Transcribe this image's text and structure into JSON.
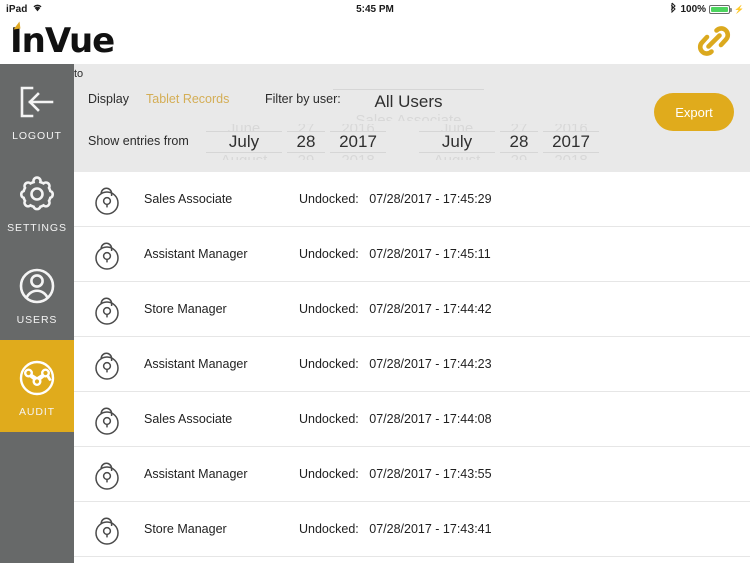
{
  "statusbar": {
    "device": "iPad",
    "wifi_icon": "wifi-icon",
    "time": "5:45 PM",
    "bluetooth_icon": "bluetooth-icon",
    "battery_percent": "100%",
    "charging_icon": "charging-bolt-icon"
  },
  "brand": {
    "logo_text": "InVue",
    "logo_accent_color": "#e0a924",
    "link_icon": "chain-link-icon",
    "link_icon_color": "#e0ab1c"
  },
  "theme": {
    "accent": "#e0ab1c",
    "sidebar_bg": "#676969",
    "filterbar_bg": "#e9e9e9",
    "muted_gold": "#d4ae56"
  },
  "sidebar": {
    "items": [
      {
        "label": "LOGOUT",
        "icon": "logout-arrow-icon",
        "active": false
      },
      {
        "label": "SETTINGS",
        "icon": "gear-icon",
        "active": false
      },
      {
        "label": "USERS",
        "icon": "user-circle-icon",
        "active": false
      },
      {
        "label": "AUDIT",
        "icon": "network-graph-icon",
        "active": true
      }
    ]
  },
  "filterbar": {
    "display_label": "Display",
    "display_value": "Tablet Records",
    "filter_by_user_label": "Filter by user:",
    "user_picker": {
      "selected": "All Users",
      "next_option": "Sales Associate"
    },
    "show_entries_label": "Show entries from",
    "to_label": "to",
    "from_date": {
      "month": "July",
      "day": "28",
      "year": "2017"
    },
    "to_date": {
      "month": "July",
      "day": "28",
      "year": "2017"
    },
    "export_label": "Export"
  },
  "records": [
    {
      "icon": "unlocked-padlock-icon",
      "role": "Sales Associate",
      "event": "Undocked:",
      "timestamp": "07/28/2017 - 17:45:29"
    },
    {
      "icon": "unlocked-padlock-icon",
      "role": "Assistant Manager",
      "event": "Undocked:",
      "timestamp": "07/28/2017 - 17:45:11"
    },
    {
      "icon": "unlocked-padlock-icon",
      "role": "Store Manager",
      "event": "Undocked:",
      "timestamp": "07/28/2017 - 17:44:42"
    },
    {
      "icon": "unlocked-padlock-icon",
      "role": "Assistant Manager",
      "event": "Undocked:",
      "timestamp": "07/28/2017 - 17:44:23"
    },
    {
      "icon": "unlocked-padlock-icon",
      "role": "Sales Associate",
      "event": "Undocked:",
      "timestamp": "07/28/2017 - 17:44:08"
    },
    {
      "icon": "unlocked-padlock-icon",
      "role": "Assistant Manager",
      "event": "Undocked:",
      "timestamp": "07/28/2017 - 17:43:55"
    },
    {
      "icon": "unlocked-padlock-icon",
      "role": "Store Manager",
      "event": "Undocked:",
      "timestamp": "07/28/2017 - 17:43:41"
    }
  ]
}
